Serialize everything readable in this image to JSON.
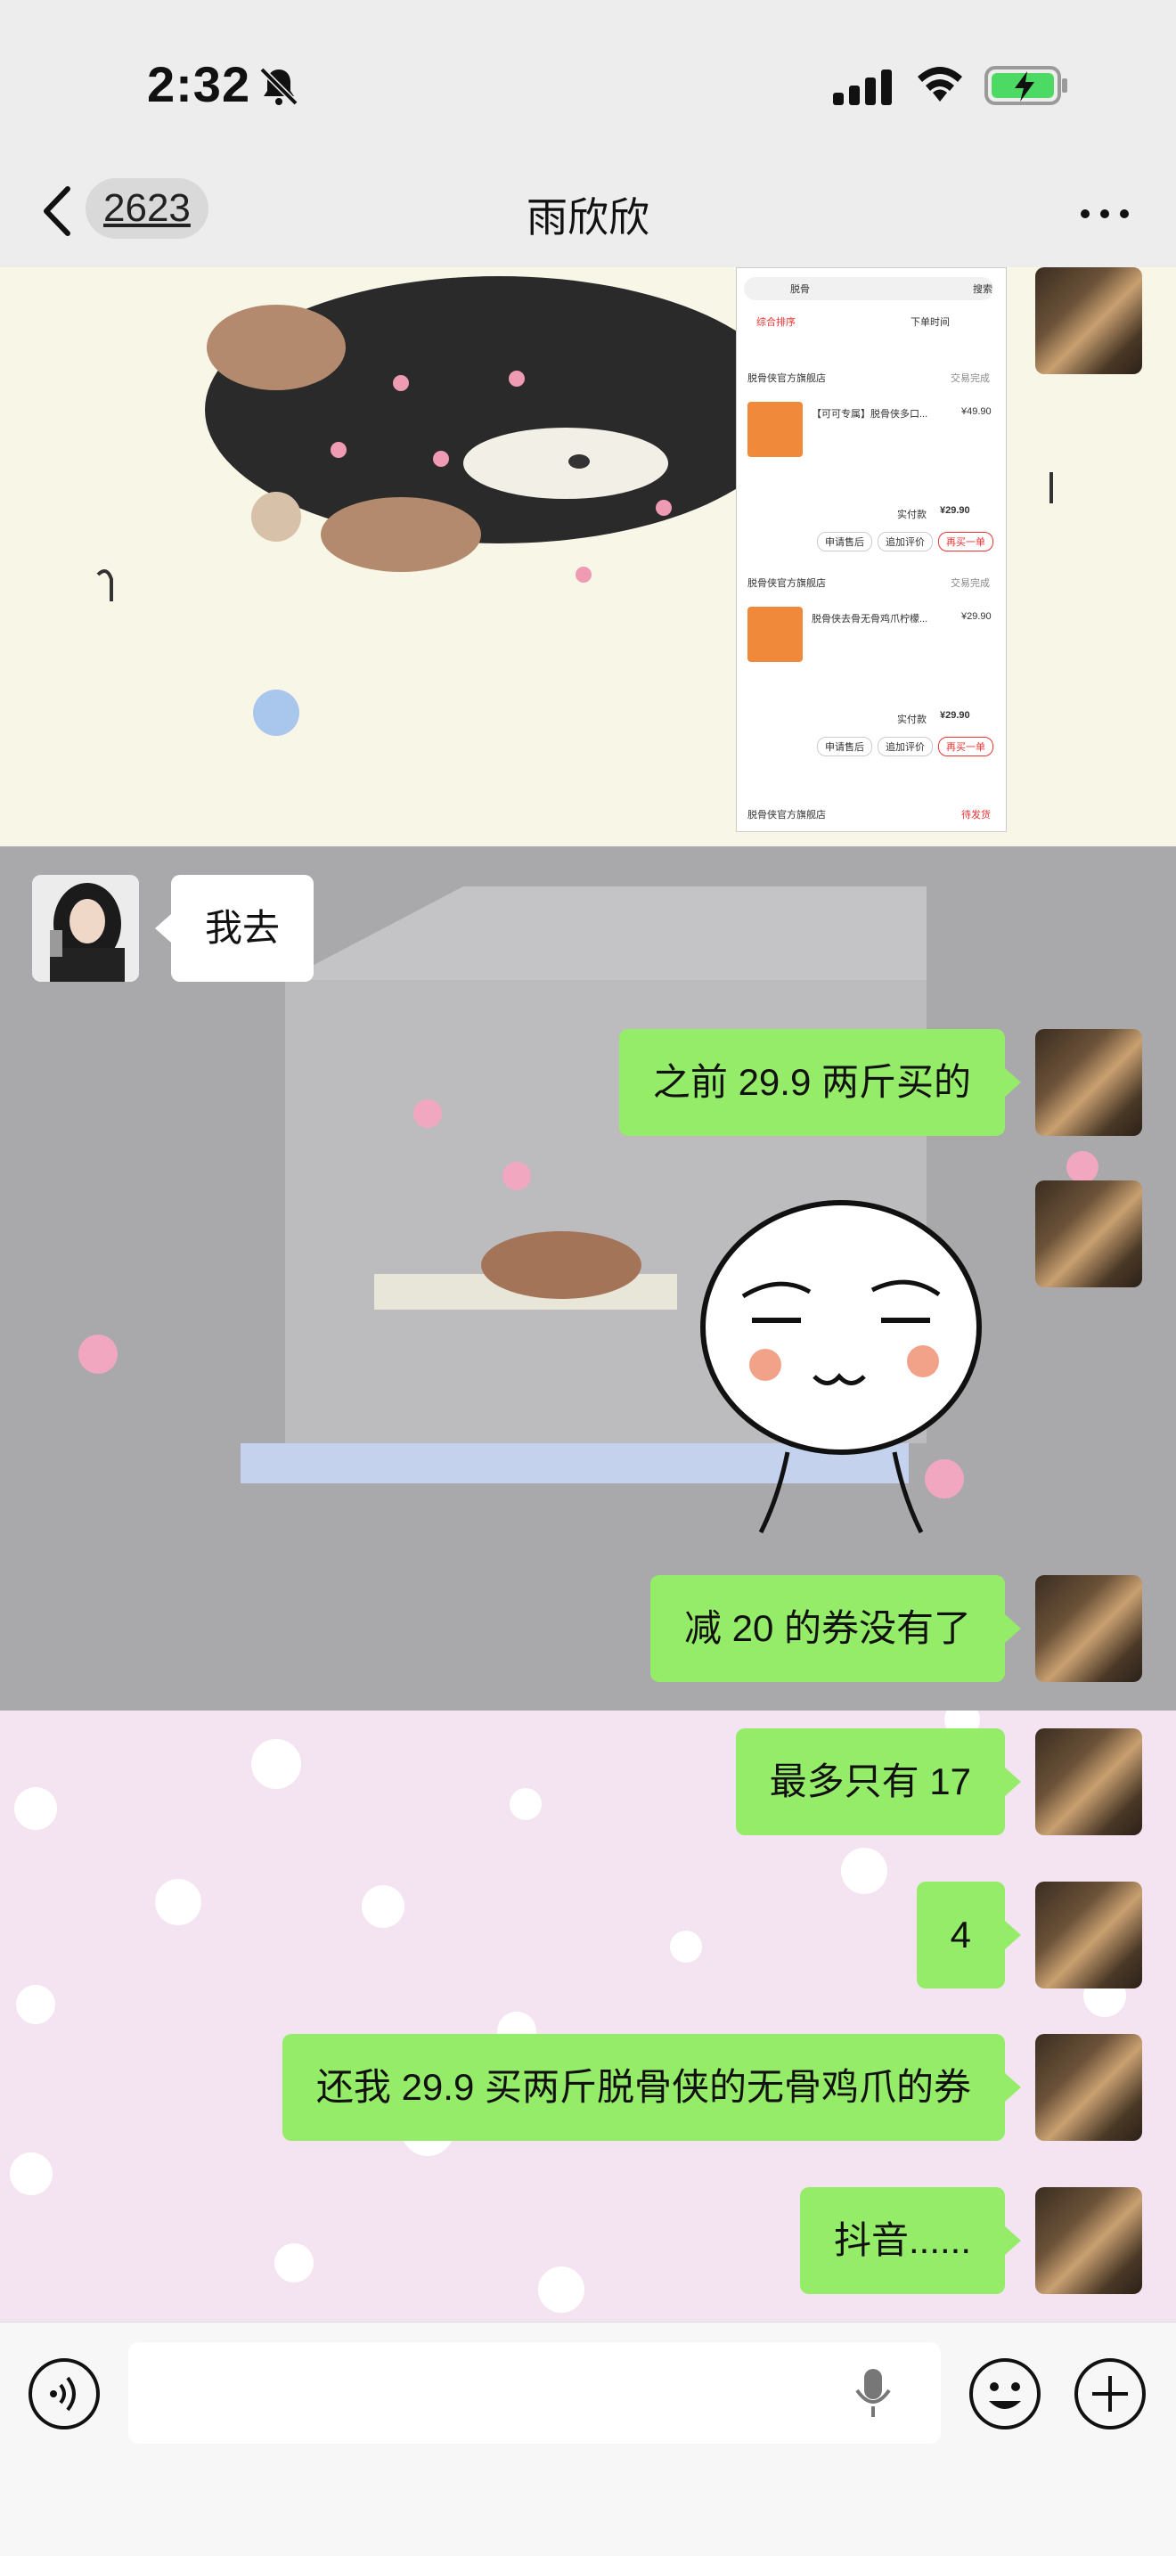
{
  "status_bar": {
    "time": "2:32"
  },
  "nav": {
    "unread_count": "2623",
    "title": "雨欣欣"
  },
  "screenshot_card": {
    "search_text": "脱骨",
    "search_button": "搜索",
    "sort_left": "综合排序",
    "sort_right": "下单时间",
    "store_name": "脱骨侠官方旗舰店",
    "order_status": "交易完成",
    "item1_title": "【可可专属】脱骨侠多口...",
    "item1_price": "¥49.90",
    "item2_title": "脱骨侠去骨无骨鸡爪柠檬...",
    "item2_price": "¥29.90",
    "paid_label": "实付款",
    "paid_value": "¥29.90",
    "btn_after_sale": "申请售后",
    "btn_review": "追加评价",
    "btn_rebuy": "再买一单",
    "pending_status": "待发货"
  },
  "messages": {
    "her_1": "我去",
    "me_1": "之前 29.9 两斤买的",
    "me_2": "减 20 的券没有了",
    "me_3": "最多只有 17",
    "me_4": "4",
    "me_5": "还我 29.9 买两斤脱骨侠的无骨鸡爪的券",
    "me_6": "抖音......"
  }
}
